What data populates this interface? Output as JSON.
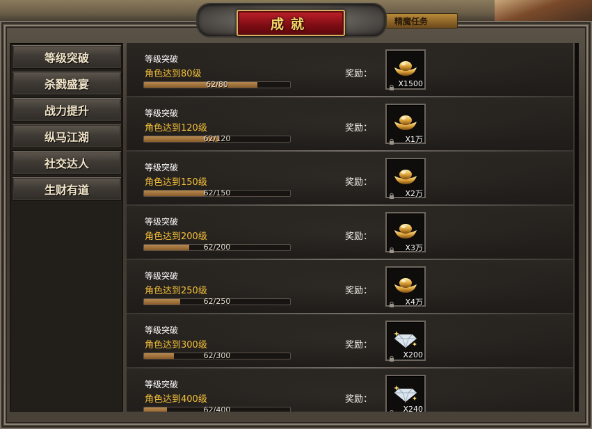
{
  "window": {
    "title": "成就",
    "side_tab_label": "精魔任务"
  },
  "menu": {
    "items": [
      {
        "label": "等级突破"
      },
      {
        "label": "杀戮盛宴"
      },
      {
        "label": "战力提升"
      },
      {
        "label": "纵马江湖"
      },
      {
        "label": "社交达人"
      },
      {
        "label": "生财有道"
      }
    ]
  },
  "achievements": [
    {
      "title": "等级突破",
      "desc": "角色达到80级",
      "progress_text": "62/80",
      "progress": 0.775,
      "reward_label": "奖励：",
      "reward_icon": "gold-ingot-icon",
      "reward_qty": "X1500"
    },
    {
      "title": "等级突破",
      "desc": "角色达到120级",
      "progress_text": "62/120",
      "progress": 0.517,
      "reward_label": "奖励：",
      "reward_icon": "gold-ingot-icon",
      "reward_qty": "X1万"
    },
    {
      "title": "等级突破",
      "desc": "角色达到150级",
      "progress_text": "62/150",
      "progress": 0.413,
      "reward_label": "奖励：",
      "reward_icon": "gold-ingot-icon",
      "reward_qty": "X2万"
    },
    {
      "title": "等级突破",
      "desc": "角色达到200级",
      "progress_text": "62/200",
      "progress": 0.31,
      "reward_label": "奖励：",
      "reward_icon": "gold-ingot-icon",
      "reward_qty": "X3万"
    },
    {
      "title": "等级突破",
      "desc": "角色达到250级",
      "progress_text": "62/250",
      "progress": 0.248,
      "reward_label": "奖励：",
      "reward_icon": "gold-ingot-icon",
      "reward_qty": "X4万"
    },
    {
      "title": "等级突破",
      "desc": "角色达到300级",
      "progress_text": "62/300",
      "progress": 0.207,
      "reward_label": "奖励：",
      "reward_icon": "diamond-icon",
      "reward_qty": "X200"
    },
    {
      "title": "等级突破",
      "desc": "角色达到400级",
      "progress_text": "62/400",
      "progress": 0.155,
      "reward_label": "奖励：",
      "reward_icon": "diamond-icon",
      "reward_qty": "X240"
    }
  ],
  "colors": {
    "title_red": "#c2202a",
    "desc_gold": "#f5c03a",
    "progress_fill": "#b88a52"
  }
}
